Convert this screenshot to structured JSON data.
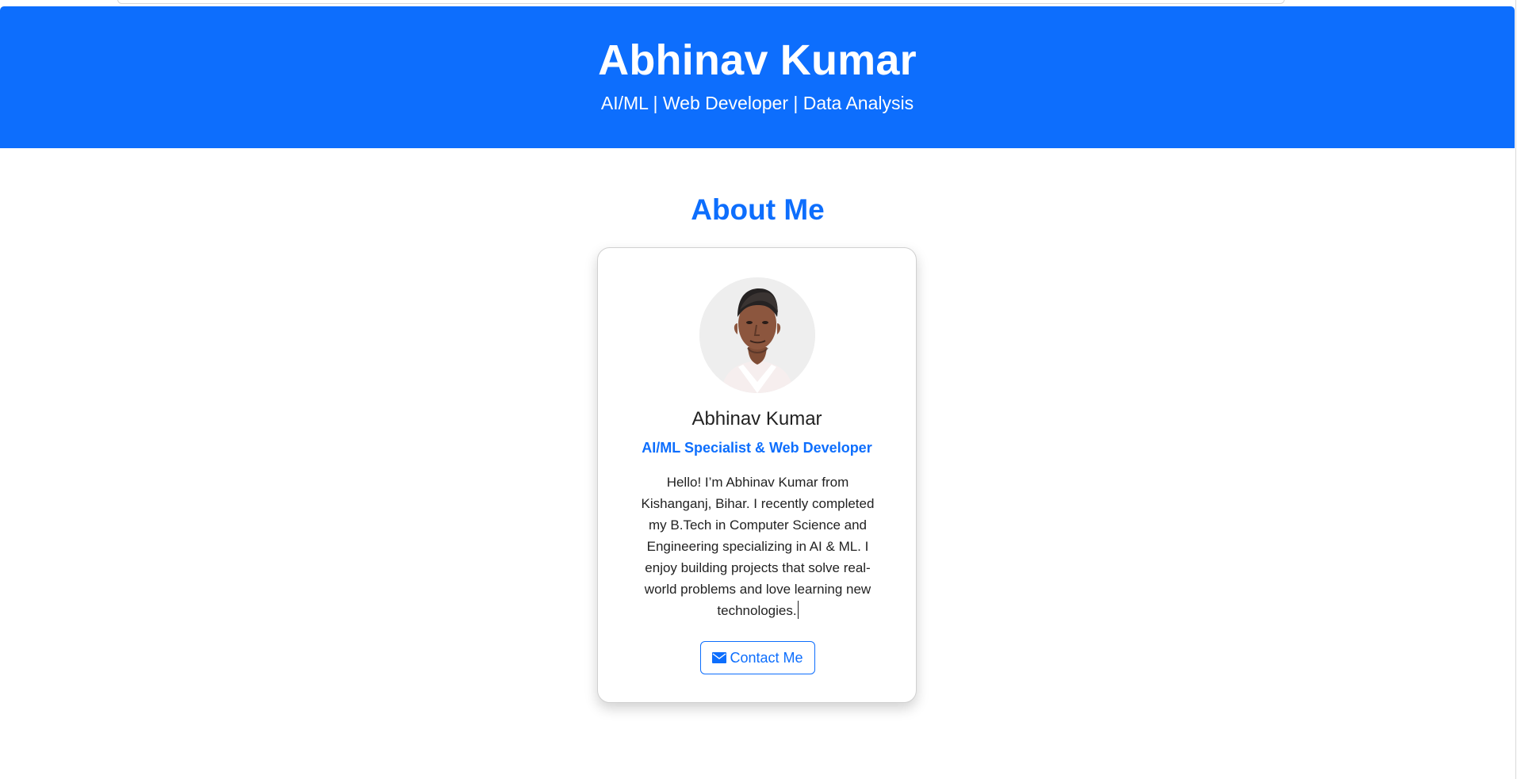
{
  "header": {
    "title": "Abhinav Kumar",
    "subtitle": "AI/ML | Web Developer | Data Analysis"
  },
  "about": {
    "section_title": "About Me",
    "profile": {
      "name": "Abhinav Kumar",
      "role": "AI/ML Specialist & Web Developer",
      "bio": "Hello! I’m Abhinav Kumar from Kishanganj, Bihar. I recently completed my B.Tech in Computer Science and Engineering specializing in AI & ML. I enjoy building projects that solve real-world problems and love learning new technologies.",
      "avatar_icon": "profile-photo"
    },
    "contact_button": {
      "icon": "envelope-icon",
      "label": "Contact Me"
    }
  },
  "colors": {
    "header_blue": "#0d6efd",
    "section_blue": "#0d6efd",
    "text_dark": "#222222",
    "card_border": "#d0d0d0",
    "page_background": "#ffffff"
  }
}
